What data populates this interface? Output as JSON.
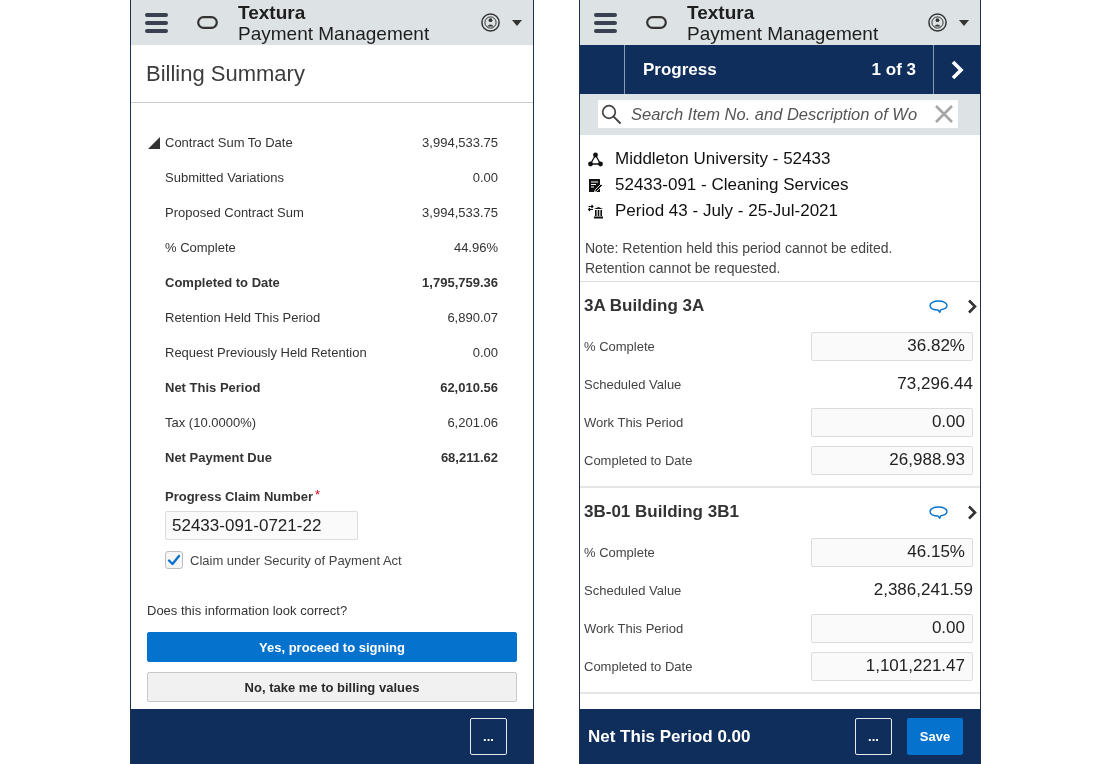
{
  "billing": {
    "header": {
      "brand": "Textura",
      "product": "Payment Management"
    },
    "title": "Billing Summary",
    "summary": {
      "label": "Contract Sum To Date",
      "value": "3,994,533.75",
      "expanded": true,
      "rows": [
        {
          "label": "Submitted Variations",
          "value": "0.00",
          "emphasized": false
        },
        {
          "label": "Proposed Contract Sum",
          "value": "3,994,533.75",
          "emphasized": false
        },
        {
          "label": "% Complete",
          "value": "44.96%",
          "emphasized": false
        },
        {
          "label": "Completed to Date",
          "value": "1,795,759.36",
          "emphasized": true
        },
        {
          "label": "Retention Held This Period",
          "value": "6,890.07",
          "emphasized": false
        },
        {
          "label": "Request Previously Held Retention",
          "value": "0.00",
          "emphasized": false
        },
        {
          "label": "Net This Period",
          "value": "62,010.56",
          "emphasized": true
        },
        {
          "label": "Tax (10.0000%)",
          "value": "6,201.06",
          "emphasized": false
        },
        {
          "label": "Net Payment Due",
          "value": "68,211.62",
          "emphasized": true
        }
      ]
    },
    "claim": {
      "label": "Progress Claim Number",
      "required_mark": "*",
      "value": "52433-091-0721-22"
    },
    "act": {
      "label": "Claim under Security of Payment Act",
      "checked": true
    },
    "question": "Does this information look correct?",
    "buttons": [
      {
        "label": "Yes, proceed to signing",
        "kind": "primary"
      },
      {
        "label": "No, take me to billing values",
        "kind": "secondary"
      }
    ],
    "footer": {
      "more": "..."
    }
  },
  "progress": {
    "header": {
      "brand": "Textura",
      "product": "Payment Management"
    },
    "nav": {
      "title": "Progress",
      "page": "1 of 3"
    },
    "search": {
      "placeholder": "Search Item No. and Description of Wo"
    },
    "context": [
      {
        "kind": "project",
        "text": "Middleton University - 52433"
      },
      {
        "kind": "contract",
        "text": "52433-091 - Cleaning Services"
      },
      {
        "kind": "period",
        "text": "Period 43 - July - 25-Jul-2021"
      }
    ],
    "note": [
      "Note: Retention held this period cannot be edited.",
      "Retention cannot be requested."
    ],
    "items": [
      {
        "title": "3A Building 3A",
        "fields": [
          {
            "label": "% Complete",
            "value": "36.82%",
            "editable": true
          },
          {
            "label": "Scheduled Value",
            "value": "73,296.44",
            "editable": false
          },
          {
            "label": "Work This Period",
            "value": "0.00",
            "editable": true
          },
          {
            "label": "Completed to Date",
            "value": "26,988.93",
            "editable": true
          }
        ]
      },
      {
        "title": "3B-01 Building 3B1",
        "fields": [
          {
            "label": "% Complete",
            "value": "46.15%",
            "editable": true
          },
          {
            "label": "Scheduled Value",
            "value": "2,386,241.59",
            "editable": false
          },
          {
            "label": "Work This Period",
            "value": "0.00",
            "editable": true
          },
          {
            "label": "Completed to Date",
            "value": "1,101,221.47",
            "editable": true
          }
        ]
      }
    ],
    "footer": {
      "total": "Net This Period 0.00",
      "more": "...",
      "save": "Save"
    }
  }
}
